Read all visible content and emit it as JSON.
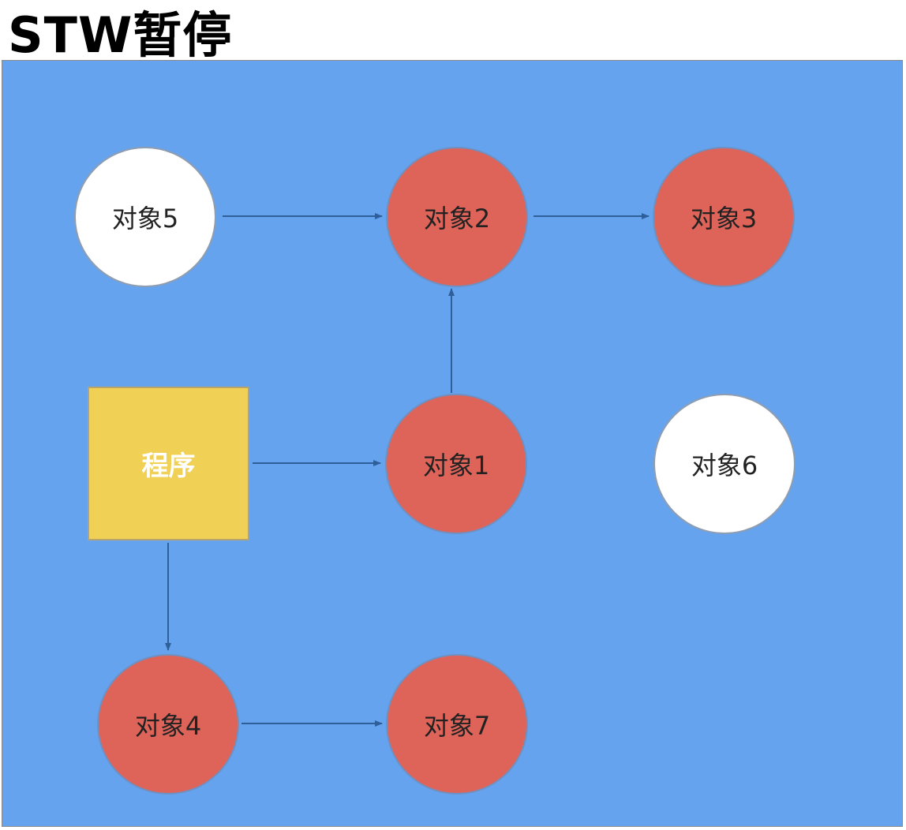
{
  "title": "STW暂停",
  "diagram": {
    "program": {
      "label": "程序"
    },
    "objects": [
      {
        "id": "obj1",
        "label": "对象1",
        "state": "marked"
      },
      {
        "id": "obj2",
        "label": "对象2",
        "state": "marked"
      },
      {
        "id": "obj3",
        "label": "对象3",
        "state": "marked"
      },
      {
        "id": "obj4",
        "label": "对象4",
        "state": "marked"
      },
      {
        "id": "obj5",
        "label": "对象5",
        "state": "unmarked"
      },
      {
        "id": "obj6",
        "label": "对象6",
        "state": "unmarked"
      },
      {
        "id": "obj7",
        "label": "对象7",
        "state": "marked"
      }
    ],
    "edges": [
      {
        "from": "obj5",
        "to": "obj2"
      },
      {
        "from": "obj2",
        "to": "obj3"
      },
      {
        "from": "obj1",
        "to": "obj2"
      },
      {
        "from": "program",
        "to": "obj1"
      },
      {
        "from": "program",
        "to": "obj4"
      },
      {
        "from": "obj4",
        "to": "obj7"
      }
    ],
    "colors": {
      "background": "#66a3ee",
      "marked": "#de645a",
      "unmarked": "#ffffff",
      "program": "#f0d055",
      "edge": "#2f5f99"
    }
  }
}
